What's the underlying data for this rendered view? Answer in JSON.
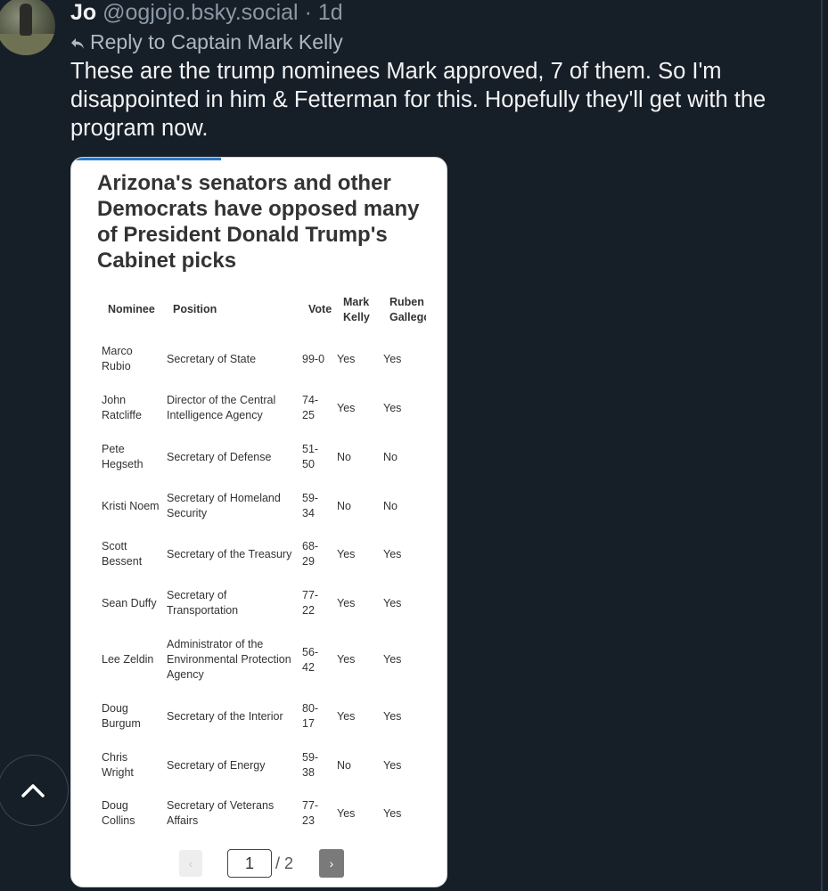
{
  "post": {
    "author_name": "Jo",
    "author_handle": "@ogjojo.bsky.social",
    "separator": "·",
    "time": "1d",
    "reply_to": "Reply to Captain Mark Kelly",
    "text": "These are the trump nominees Mark approved, 7 of them. So I'm disappointed in him & Fetterman for this. Hopefully they'll get with the program now."
  },
  "embed": {
    "title": "Arizona's senators and other Democrats have opposed many of President Donald Trump's Cabinet picks",
    "columns": {
      "nominee": "Nominee",
      "position": "Position",
      "vote": "Vote",
      "kelly_1": "Mark",
      "kelly_2": "Kelly",
      "gallego_1": "Ruben",
      "gallego_2": "Gallego"
    },
    "rows": [
      {
        "nominee": "Marco Rubio",
        "position": "Secretary of State",
        "vote": "99-0",
        "kelly": "Yes",
        "gallego": "Yes"
      },
      {
        "nominee": "John Ratcliffe",
        "position": "Director of the Central Intelligence Agency",
        "vote": "74-25",
        "kelly": "Yes",
        "gallego": "Yes"
      },
      {
        "nominee": "Pete Hegseth",
        "position": "Secretary of Defense",
        "vote": "51-50",
        "kelly": "No",
        "gallego": "No"
      },
      {
        "nominee": "Kristi Noem",
        "position": "Secretary of Homeland Security",
        "vote": "59-34",
        "kelly": "No",
        "gallego": "No"
      },
      {
        "nominee": "Scott Bessent",
        "position": "Secretary of the Treasury",
        "vote": "68-29",
        "kelly": "Yes",
        "gallego": "Yes"
      },
      {
        "nominee": "Sean Duffy",
        "position": "Secretary of Transportation",
        "vote": "77-22",
        "kelly": "Yes",
        "gallego": "Yes"
      },
      {
        "nominee": "Lee Zeldin",
        "position": "Administrator of the Environmental Protection Agency",
        "vote": "56-42",
        "kelly": "Yes",
        "gallego": "Yes"
      },
      {
        "nominee": "Doug Burgum",
        "position": "Secretary of the Interior",
        "vote": "80-17",
        "kelly": "Yes",
        "gallego": "Yes"
      },
      {
        "nominee": "Chris Wright",
        "position": "Secretary of Energy",
        "vote": "59-38",
        "kelly": "No",
        "gallego": "Yes"
      },
      {
        "nominee": "Doug Collins",
        "position": "Secretary of Veterans Affairs",
        "vote": "77-23",
        "kelly": "Yes",
        "gallego": "Yes"
      }
    ],
    "pager": {
      "prev": "‹",
      "current_page": "1",
      "total": "/ 2",
      "next": "›"
    }
  },
  "icons": {
    "reply": "reply-icon",
    "scroll_top": "chevron-up-icon",
    "avatar": "avatar"
  },
  "colors": {
    "background": "#161e27",
    "muted_text": "#8b98a5",
    "card_background": "#ffffff",
    "card_accent": "#2b78c5"
  }
}
